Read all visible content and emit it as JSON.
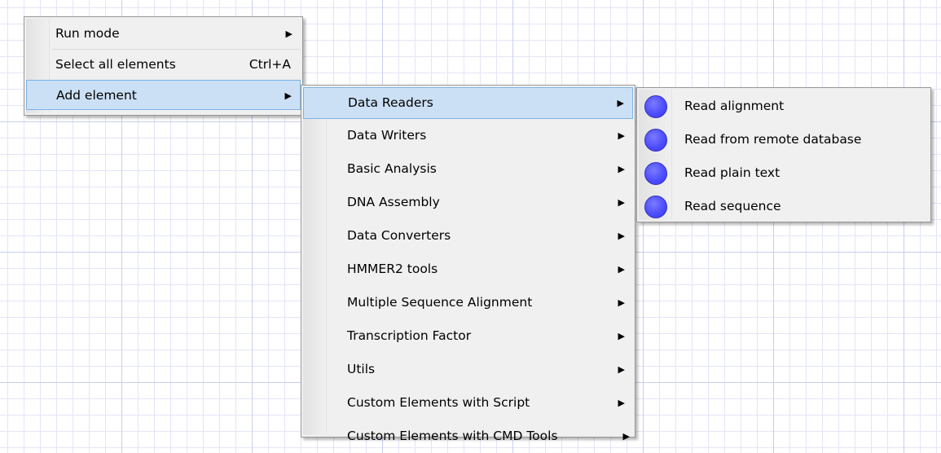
{
  "context_menu": {
    "items": [
      {
        "label": "Run mode",
        "arrow": "▶"
      },
      {
        "label": "Select all elements",
        "shortcut": "Ctrl+A"
      },
      {
        "label": "Add element",
        "arrow": "▶"
      }
    ]
  },
  "add_element_submenu": {
    "items": [
      {
        "label": "Data Readers",
        "arrow": "▶"
      },
      {
        "label": "Data Writers",
        "arrow": "▶"
      },
      {
        "label": "Basic Analysis",
        "arrow": "▶"
      },
      {
        "label": "DNA Assembly",
        "arrow": "▶"
      },
      {
        "label": "Data Converters",
        "arrow": "▶"
      },
      {
        "label": "HMMER2 tools",
        "arrow": "▶"
      },
      {
        "label": "Multiple Sequence Alignment",
        "arrow": "▶"
      },
      {
        "label": "Transcription Factor",
        "arrow": "▶"
      },
      {
        "label": "Utils",
        "arrow": "▶"
      },
      {
        "label": "Custom Elements with Script",
        "arrow": "▶"
      },
      {
        "label": "Custom Elements with CMD Tools",
        "arrow": "▶"
      }
    ]
  },
  "data_readers_submenu": {
    "items": [
      {
        "label": "Read alignment",
        "icon": "blue-circle-icon"
      },
      {
        "label": "Read from remote database",
        "icon": "blue-circle-icon"
      },
      {
        "label": "Read plain text",
        "icon": "blue-circle-icon"
      },
      {
        "label": "Read sequence",
        "icon": "blue-circle-icon"
      }
    ]
  },
  "colors": {
    "highlight_bg": "#cce0f5",
    "highlight_border": "#7eb3e3",
    "menu_bg": "#f0f0f0",
    "icon_blue": "#4a4aff",
    "grid_line": "#c9cdf0"
  }
}
